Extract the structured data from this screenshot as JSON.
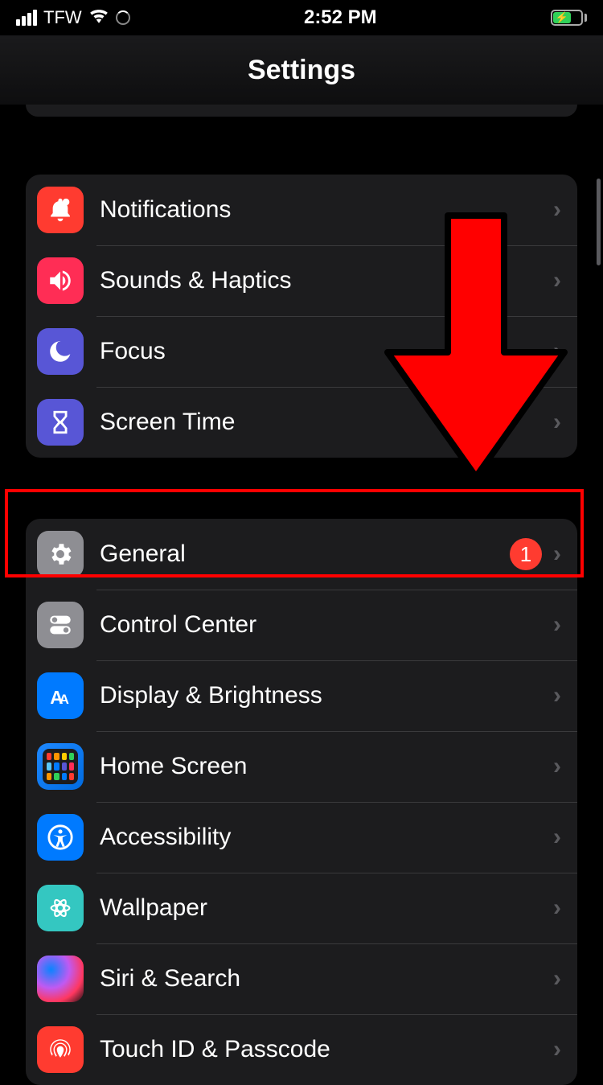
{
  "statusBar": {
    "carrier": "TFW",
    "time": "2:52 PM"
  },
  "header": {
    "title": "Settings"
  },
  "group1": {
    "items": [
      {
        "label": "Notifications"
      },
      {
        "label": "Sounds & Haptics"
      },
      {
        "label": "Focus"
      },
      {
        "label": "Screen Time"
      }
    ]
  },
  "group2": {
    "items": [
      {
        "label": "General",
        "badge": "1"
      },
      {
        "label": "Control Center"
      },
      {
        "label": "Display & Brightness"
      },
      {
        "label": "Home Screen"
      },
      {
        "label": "Accessibility"
      },
      {
        "label": "Wallpaper"
      },
      {
        "label": "Siri & Search"
      },
      {
        "label": "Touch ID & Passcode"
      }
    ]
  },
  "annotations": {
    "arrow_color": "#ff0000",
    "highlight_target": "General"
  }
}
